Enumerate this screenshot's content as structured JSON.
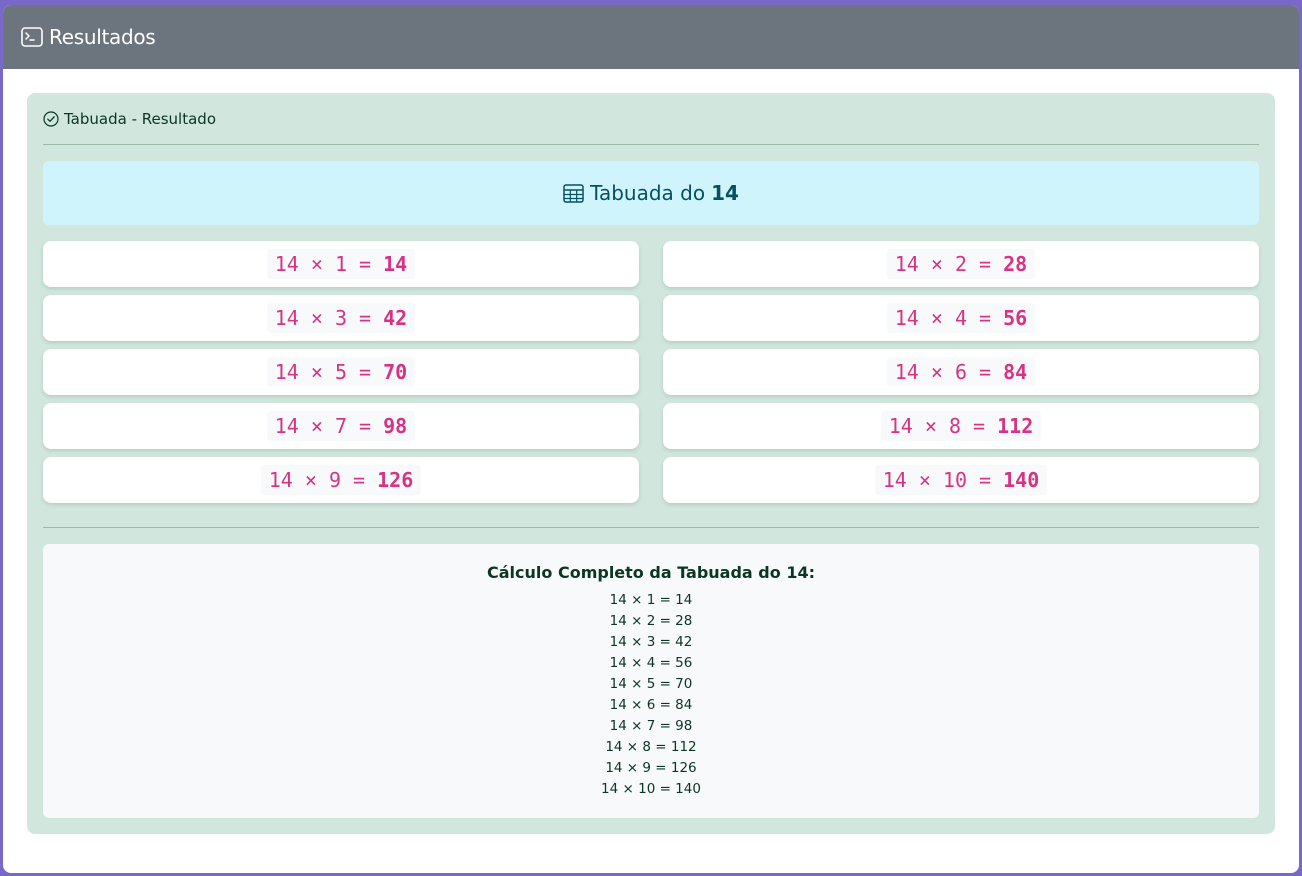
{
  "header": {
    "title": "Resultados",
    "icon": "terminal-icon"
  },
  "card": {
    "title": "Tabuada - Resultado",
    "title_icon": "check-circle-icon",
    "banner": {
      "prefix": "Tabuada do",
      "number": "14",
      "icon": "table-icon"
    },
    "rows": [
      {
        "expr": "14 × 1 = ",
        "result": "14"
      },
      {
        "expr": "14 × 2 = ",
        "result": "28"
      },
      {
        "expr": "14 × 3 = ",
        "result": "42"
      },
      {
        "expr": "14 × 4 = ",
        "result": "56"
      },
      {
        "expr": "14 × 5 = ",
        "result": "70"
      },
      {
        "expr": "14 × 6 = ",
        "result": "84"
      },
      {
        "expr": "14 × 7 = ",
        "result": "98"
      },
      {
        "expr": "14 × 8 = ",
        "result": "112"
      },
      {
        "expr": "14 × 9 = ",
        "result": "126"
      },
      {
        "expr": "14 × 10 = ",
        "result": "140"
      }
    ],
    "calc": {
      "title": "Cálculo Completo da Tabuada do 14:",
      "lines": [
        "14 × 1 = 14",
        "14 × 2 = 28",
        "14 × 3 = 42",
        "14 × 4 = 56",
        "14 × 5 = 70",
        "14 × 6 = 84",
        "14 × 7 = 98",
        "14 × 8 = 112",
        "14 × 9 = 126",
        "14 × 10 = 140"
      ]
    }
  },
  "colors": {
    "header_bg": "#6c757d",
    "card_bg": "#d1e7dd",
    "banner_bg": "#cff4fc",
    "code_color": "#d63384"
  }
}
